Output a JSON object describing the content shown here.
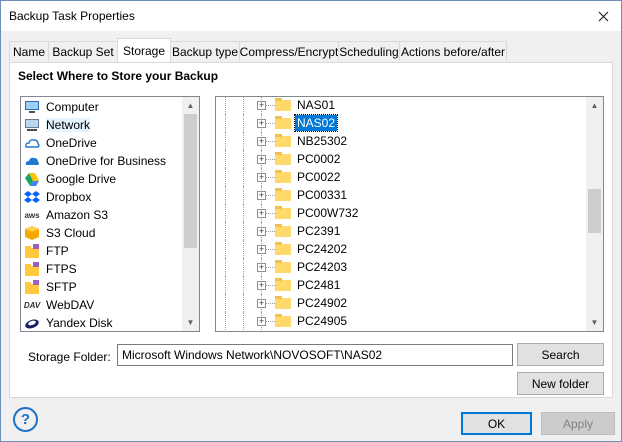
{
  "window": {
    "title": "Backup Task Properties"
  },
  "tabs": [
    {
      "label": "Name"
    },
    {
      "label": "Backup Set"
    },
    {
      "label": "Storage",
      "active": true
    },
    {
      "label": "Backup type"
    },
    {
      "label": "Compress/Encrypt"
    },
    {
      "label": "Scheduling"
    },
    {
      "label": "Actions before/after"
    }
  ],
  "panel": {
    "heading": "Select Where to Store your Backup"
  },
  "locations": [
    {
      "label": "Computer",
      "icon": "computer-icon"
    },
    {
      "label": "Network",
      "icon": "network-icon",
      "selected": true
    },
    {
      "label": "OneDrive",
      "icon": "onedrive-icon"
    },
    {
      "label": "OneDrive for Business",
      "icon": "onedrive-business-icon"
    },
    {
      "label": "Google Drive",
      "icon": "google-drive-icon"
    },
    {
      "label": "Dropbox",
      "icon": "dropbox-icon"
    },
    {
      "label": "Amazon S3",
      "icon": "amazon-s3-icon",
      "icon_text": "aws"
    },
    {
      "label": "S3 Cloud",
      "icon": "s3-cloud-icon"
    },
    {
      "label": "FTP",
      "icon": "ftp-icon"
    },
    {
      "label": "FTPS",
      "icon": "ftps-icon"
    },
    {
      "label": "SFTP",
      "icon": "sftp-icon"
    },
    {
      "label": "WebDAV",
      "icon": "webdav-icon",
      "icon_text": "DAV"
    },
    {
      "label": "Yandex Disk",
      "icon": "yandex-disk-icon"
    }
  ],
  "tree": {
    "items": [
      {
        "name": "NAS01"
      },
      {
        "name": "NAS02",
        "selected": true
      },
      {
        "name": "NB25302"
      },
      {
        "name": "PC0002"
      },
      {
        "name": "PC0022"
      },
      {
        "name": "PC00331"
      },
      {
        "name": "PC00W732"
      },
      {
        "name": "PC2391"
      },
      {
        "name": "PC24202"
      },
      {
        "name": "PC24203"
      },
      {
        "name": "PC2481"
      },
      {
        "name": "PC24902"
      },
      {
        "name": "PC24905"
      }
    ]
  },
  "storage_folder": {
    "label": "Storage Folder:",
    "value": "Microsoft Windows Network\\NOVOSOFT\\NAS02"
  },
  "buttons": {
    "search": "Search",
    "new_folder": "New folder",
    "ok": "OK",
    "apply": "Apply",
    "help": "?"
  },
  "colors": {
    "selection": "#0078d7",
    "folder": "#ffd96b",
    "help": "#1f6fc5"
  }
}
